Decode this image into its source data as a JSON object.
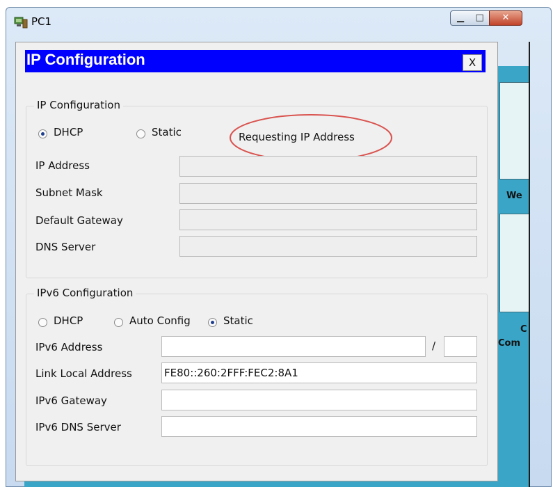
{
  "window": {
    "title": "PC1",
    "minimize_glyph": "▁",
    "maximize_glyph": "□",
    "close_glyph": "✕"
  },
  "dialog": {
    "title": "IP Configuration",
    "close_label": "X"
  },
  "ipv4": {
    "legend": "IP Configuration",
    "dhcp_label": "DHCP",
    "static_label": "Static",
    "mode": "DHCP",
    "status_text": "Requesting IP Address",
    "fields": [
      {
        "label": "IP Address",
        "value": ""
      },
      {
        "label": "Subnet Mask",
        "value": ""
      },
      {
        "label": "Default Gateway",
        "value": ""
      },
      {
        "label": "DNS Server",
        "value": ""
      }
    ]
  },
  "ipv6": {
    "legend": "IPv6 Configuration",
    "dhcp_label": "DHCP",
    "auto_label": "Auto Config",
    "static_label": "Static",
    "mode": "Static",
    "address_label": "IPv6 Address",
    "address_value": "",
    "prefix_separator": "/",
    "prefix_value": "",
    "link_local_label": "Link Local Address",
    "link_local_value": "FE80::260:2FFF:FEC2:8A1",
    "gateway_label": "IPv6 Gateway",
    "gateway_value": "",
    "dns_label": "IPv6 DNS Server",
    "dns_value": ""
  },
  "background_panel": {
    "label_1": "We",
    "label_2a": "C",
    "label_2b": "Com"
  },
  "colors": {
    "dialog_title_bg": "#0000ff",
    "teal": "#3aa5c7",
    "annotation": "#d9534f"
  }
}
